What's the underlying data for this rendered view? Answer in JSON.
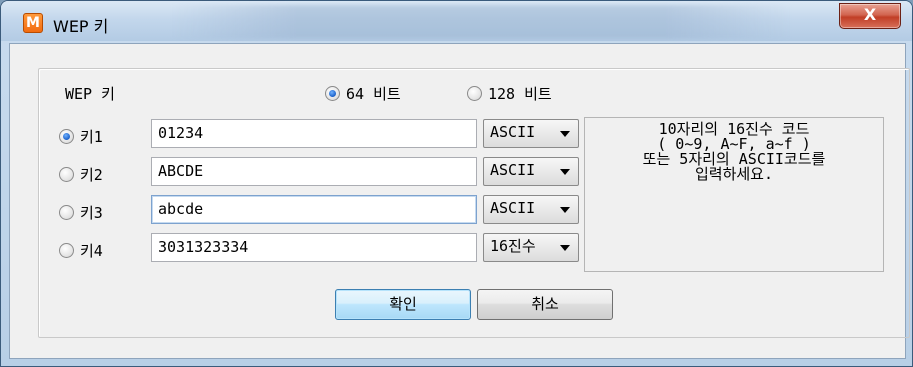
{
  "window": {
    "title": "WEP 키",
    "app_icon_letter": "M",
    "close_glyph": "X"
  },
  "group": {
    "label": "WEP 키",
    "bits": [
      {
        "label": "64 비트",
        "checked": true
      },
      {
        "label": "128 비트",
        "checked": false
      }
    ]
  },
  "keys": [
    {
      "label": "키1",
      "value": "01234",
      "format": "ASCII",
      "checked": true,
      "focused": false
    },
    {
      "label": "키2",
      "value": "ABCDE",
      "format": "ASCII",
      "checked": false,
      "focused": false
    },
    {
      "label": "키3",
      "value": "abcde",
      "format": "ASCII",
      "checked": false,
      "focused": true
    },
    {
      "label": "키4",
      "value": "3031323334",
      "format": "16진수",
      "checked": false,
      "focused": false
    }
  ],
  "help": {
    "lines": [
      "10자리의 16진수 코드",
      "( 0~9, A~F, a~f )",
      "또는 5자리의 ASCII코드를",
      "입력하세요."
    ]
  },
  "buttons": {
    "ok_label": "확인",
    "cancel_label": "취소"
  },
  "colors": {
    "radio_checked": "#1a5fc8",
    "default_button_border": "#3c7fb1",
    "close_button": "#c13e26",
    "app_icon": "#f26b10"
  },
  "icons": {
    "app": "app-logo-icon",
    "close": "close-icon",
    "dropdown": "chevron-down-icon"
  }
}
